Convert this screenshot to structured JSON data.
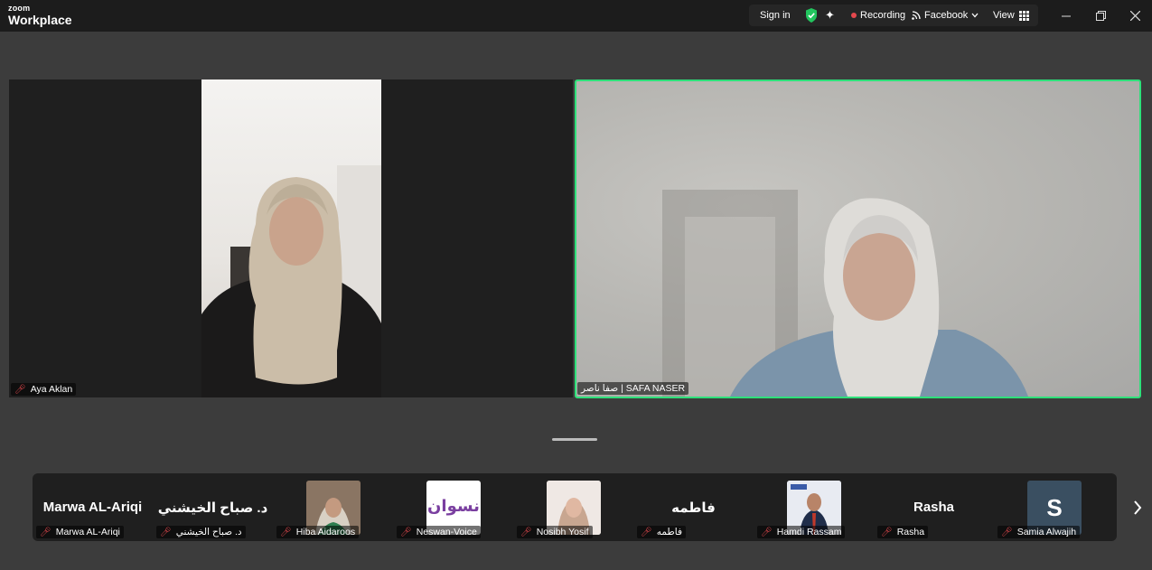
{
  "app": {
    "brand_top": "zoom",
    "brand_bottom": "Workplace"
  },
  "toolbar": {
    "sign_in": "Sign in",
    "recording": "Recording",
    "facebook": "Facebook",
    "view": "View"
  },
  "videos": {
    "left_name": "Aya Aklan",
    "right_name": "صفا ناصر | SAFA NASER"
  },
  "gallery": [
    {
      "big": "Marwa AL-Ariqi",
      "label": "Marwa AL-Ariqi"
    },
    {
      "big": "د. صباح الخيشني",
      "label": "د. صباح الخيشني"
    },
    {
      "big": "",
      "label": "Hiba Aidaroos"
    },
    {
      "big": "",
      "label": "Neswan-Voice",
      "logo_text": "نسوان"
    },
    {
      "big": "",
      "label": "Nosibh Yosif"
    },
    {
      "big": "فاطمه",
      "label": "فاطمه"
    },
    {
      "big": "",
      "label": "Hamdi Rassam"
    },
    {
      "big": "Rasha",
      "label": "Rasha"
    },
    {
      "big": "",
      "label": "Samia Alwajih",
      "avatar_letter": "S"
    }
  ],
  "colors": {
    "active_speaker": "#2ee07a",
    "muted": "#e5484d",
    "shield": "#22c55e"
  }
}
